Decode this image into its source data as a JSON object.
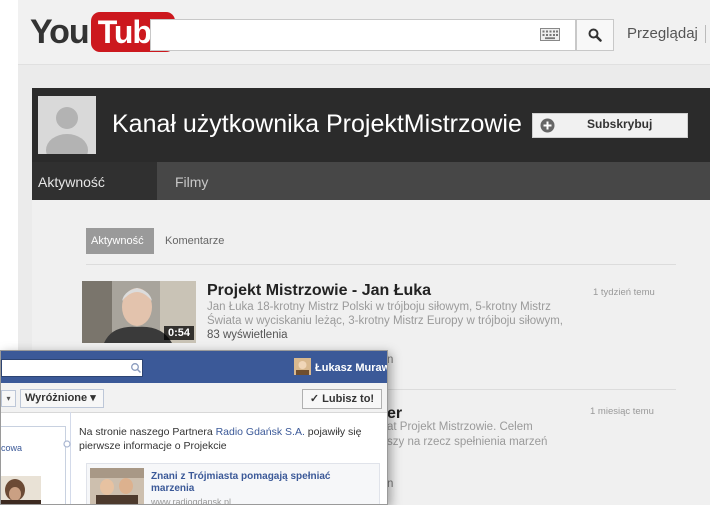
{
  "youtube": {
    "logo_you": "You",
    "logo_tube": "Tube",
    "search": {
      "placeholder": ""
    },
    "browse_label": "Przeglądaj",
    "channel": {
      "title": "Kanał użytkownika ProjektMistrzowie",
      "subscribe_label": "Subskrybuj"
    },
    "nav": {
      "activity": "Aktywność",
      "videos": "Filmy"
    },
    "tabs": {
      "activity": "Aktywność",
      "comments": "Komentarze"
    },
    "items": [
      {
        "title": "Projekt Mistrzowie - Jan Łuka",
        "description_line1": "Jan Łuka 18-krotny Mistrz Polski w trójboju siłowym, 5-krotny Mistrz",
        "description_line2": "Świata w wyciskaniu leżąc, 3-krotny Mistrz Europy w trójboju siłowym,",
        "views": "83 wyświetlenia",
        "duration": "0:54",
        "time": "1 tydzień temu",
        "fragment": "n"
      },
      {
        "title_fragment": "er",
        "description_line1": "at Projekt Mistrzowie. Celem",
        "description_line2": "szy na rzecz spełnienia marzeń",
        "fragment": "n",
        "time": "1 miesiąc temu"
      }
    ],
    "colors": {
      "banner": "#2b2b2b",
      "nav": "#474747",
      "logo_red": "#cc181e"
    }
  },
  "facebook": {
    "user_name": "Łukasz Murawski",
    "dropdown_small": "▾",
    "featured_label": "Wyróżnione ▾",
    "like_label": "✓ Lubisz to!",
    "left_panel_text": "cowa",
    "post": {
      "text_before": "Na stronie naszego Partnera ",
      "partner": "Radio Gdańsk S.A.",
      "text_after": " pojawiły się pierwsze informacje o Projekcie"
    },
    "link_card": {
      "title": "Znani z Trójmiasta pomagają spełniać marzenia",
      "url": "www.radiogdansk.pl"
    },
    "colors": {
      "bar": "#3b5998"
    }
  }
}
